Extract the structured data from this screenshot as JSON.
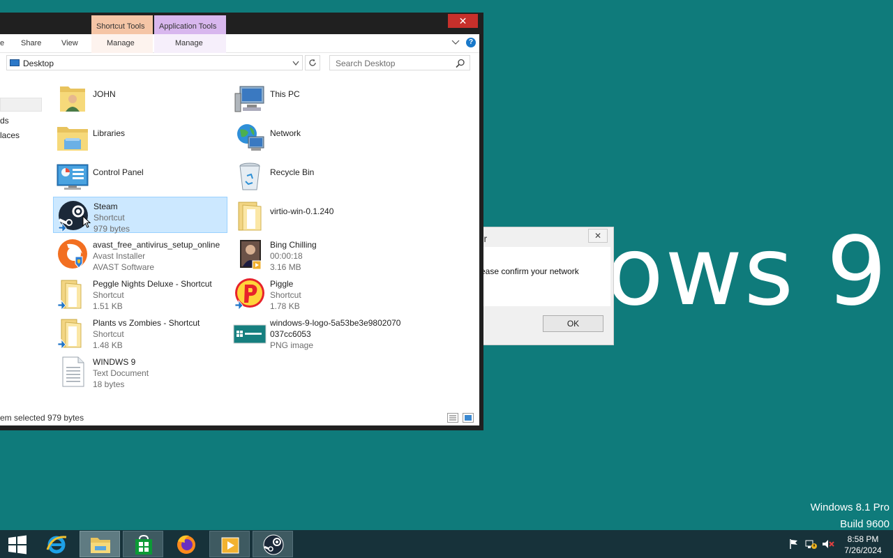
{
  "desktop": {
    "wallpaper_text": "ows 9",
    "edition_line1": "Windows 8.1 Pro",
    "edition_line2": "Build 9600"
  },
  "error_dialog": {
    "title": "ror",
    "message": "ease confirm your network",
    "ok_label": "OK",
    "close_glyph": "✕"
  },
  "explorer": {
    "contextual_tabs": {
      "shortcut_tools": "Shortcut Tools",
      "application_tools": "Application Tools"
    },
    "ribbon_tabs": {
      "home": "e",
      "share": "Share",
      "view": "View",
      "manage1": "Manage",
      "manage2": "Manage"
    },
    "close_glyph": "✕",
    "address": "Desktop",
    "search_placeholder": "Search Desktop",
    "nav_items": [
      "ds",
      "laces"
    ],
    "items": [
      {
        "name": "JOHN",
        "sub1": "",
        "sub2": "",
        "icon": "user-folder-icon"
      },
      {
        "name": "This PC",
        "sub1": "",
        "sub2": "",
        "icon": "computer-icon"
      },
      {
        "name": "Libraries",
        "sub1": "",
        "sub2": "",
        "icon": "libraries-icon"
      },
      {
        "name": "Network",
        "sub1": "",
        "sub2": "",
        "icon": "network-icon"
      },
      {
        "name": "Control Panel",
        "sub1": "",
        "sub2": "",
        "icon": "control-panel-icon"
      },
      {
        "name": "Recycle Bin",
        "sub1": "",
        "sub2": "",
        "icon": "recycle-bin-icon"
      },
      {
        "name": "Steam",
        "sub1": "Shortcut",
        "sub2": "979 bytes",
        "icon": "steam-icon",
        "selected": true
      },
      {
        "name": "virtio-win-0.1.240",
        "sub1": "",
        "sub2": "",
        "icon": "folder-icon"
      },
      {
        "name": "avast_free_antivirus_setup_online",
        "sub1": "Avast Installer",
        "sub2": "AVAST Software",
        "icon": "avast-icon"
      },
      {
        "name": "Bing Chilling",
        "sub1": "00:00:18",
        "sub2": "3.16 MB",
        "icon": "video-thumbnail-icon"
      },
      {
        "name": "Peggle Nights Deluxe - Shortcut",
        "sub1": "Shortcut",
        "sub2": "1.51 KB",
        "icon": "folder-shortcut-icon"
      },
      {
        "name": "Piggle",
        "sub1": "Shortcut",
        "sub2": "1.78 KB",
        "icon": "piggle-icon"
      },
      {
        "name": "Plants vs Zombies - Shortcut",
        "sub1": "Shortcut",
        "sub2": "1.48 KB",
        "icon": "folder-shortcut-icon"
      },
      {
        "name": "windows-9-logo-5a53be3e9802070",
        "sub1": "037cc6053",
        "sub2": "PNG image",
        "icon": "image-thumbnail-icon"
      },
      {
        "name": "WINDWS 9",
        "sub1": "Text Document",
        "sub2": "18 bytes",
        "icon": "text-document-icon"
      }
    ],
    "status": "em selected  979 bytes"
  },
  "taskbar": {
    "apps": [
      "start-icon",
      "internet-explorer-icon",
      "file-explorer-icon",
      "store-icon",
      "firefox-icon",
      "media-player-icon",
      "steam-icon"
    ],
    "time": "8:58 PM",
    "date": "7/26/2024"
  },
  "colors": {
    "desktop": "#0f7b7b",
    "taskbar": "#17323a",
    "selection": "#cce8ff",
    "close": "#c7302b"
  }
}
